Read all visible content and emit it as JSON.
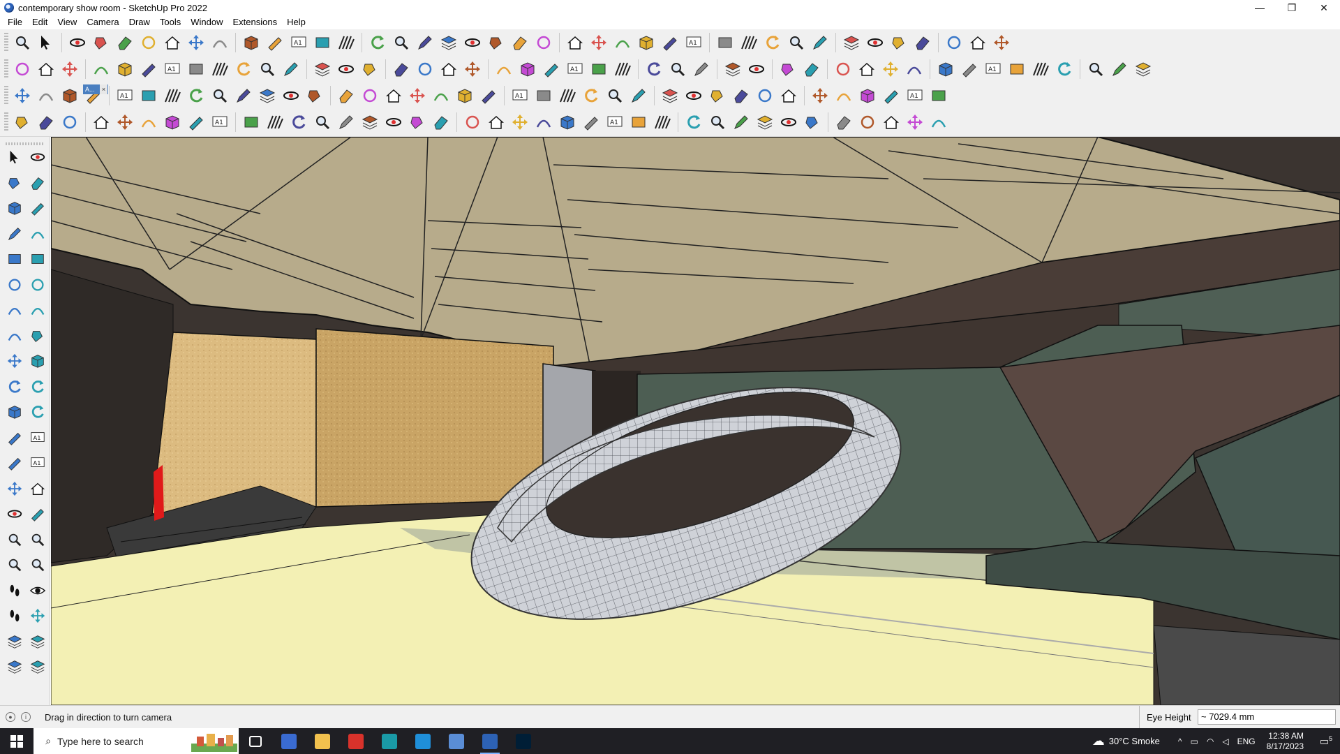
{
  "window": {
    "title": "contemporary show room - SketchUp Pro 2022",
    "controls": {
      "minimize": "—",
      "restore": "❐",
      "close": "✕"
    }
  },
  "menu": [
    "File",
    "Edit",
    "View",
    "Camera",
    "Draw",
    "Tools",
    "Window",
    "Extensions",
    "Help"
  ],
  "toolbars": {
    "floating_tag_label": "A...",
    "floating_tag_close": "×"
  },
  "status": {
    "message": "Drag in direction to turn camera",
    "measurement_label": "Eye Height",
    "measurement_value": "~ 7029.4 mm"
  },
  "taskbar": {
    "search_placeholder": "Type here to search",
    "weather": "30°C  Smoke",
    "language": "ENG",
    "time": "12:38 AM",
    "date": "8/17/2023",
    "apps": [
      "task-view",
      "calculator",
      "file-explorer",
      "acrobat",
      "3ds-max",
      "edge",
      "snipping-tool",
      "sketchup",
      "photoshop"
    ],
    "notification_count": "5"
  },
  "colors": {
    "ceiling": "#b6aa8a",
    "wall_dark": "#3d3631",
    "floor": "#f3f0b3",
    "wood_panel": "#c8a463",
    "green_panel": "#4f5f55",
    "ring": "#c9ccd2",
    "accent_red": "#e01a1a"
  }
}
